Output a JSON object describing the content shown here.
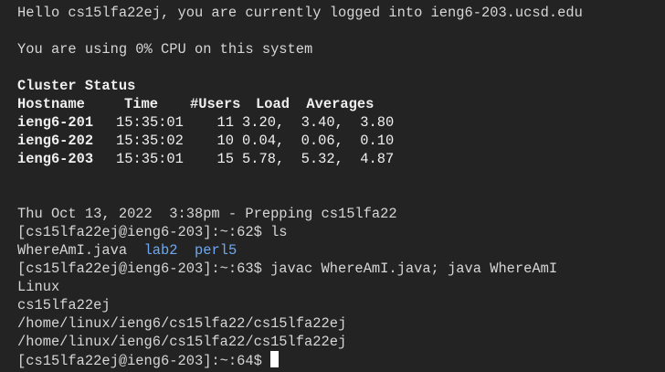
{
  "banner": {
    "greeting": "Hello cs15lfa22ej, you are currently logged into ieng6-203.ucsd.edu",
    "cpu": "You are using 0% CPU on this system"
  },
  "cluster": {
    "title": "Cluster Status",
    "headers": {
      "hostname": "Hostname",
      "time": "Time",
      "users": "#Users",
      "load": "Load  Averages"
    },
    "rows": [
      {
        "host": "ieng6-201",
        "time": "15:35:01",
        "users": "11",
        "load": "3.20,  3.40,  3.80"
      },
      {
        "host": "ieng6-202",
        "time": "15:35:02",
        "users": "10",
        "load": "0.04,  0.06,  0.10"
      },
      {
        "host": "ieng6-203",
        "time": "15:35:01",
        "users": "15",
        "load": "5.78,  5.32,  4.87"
      }
    ]
  },
  "session": {
    "date_line": "Thu Oct 13, 2022  3:38pm - Prepping cs15lfa22",
    "prompt1": "[cs15lfa22ej@ieng6-203]:~:62$ ls",
    "ls_file": "WhereAmI.java",
    "ls_dir1": "lab2",
    "ls_dir2": "perl5",
    "prompt2": "[cs15lfa22ej@ieng6-203]:~:63$ javac WhereAmI.java; java WhereAmI",
    "out1": "Linux",
    "out2": "cs15lfa22ej",
    "out3": "/home/linux/ieng6/cs15lfa22/cs15lfa22ej",
    "out4": "/home/linux/ieng6/cs15lfa22/cs15lfa22ej",
    "prompt3": "[cs15lfa22ej@ieng6-203]:~:64$ "
  }
}
